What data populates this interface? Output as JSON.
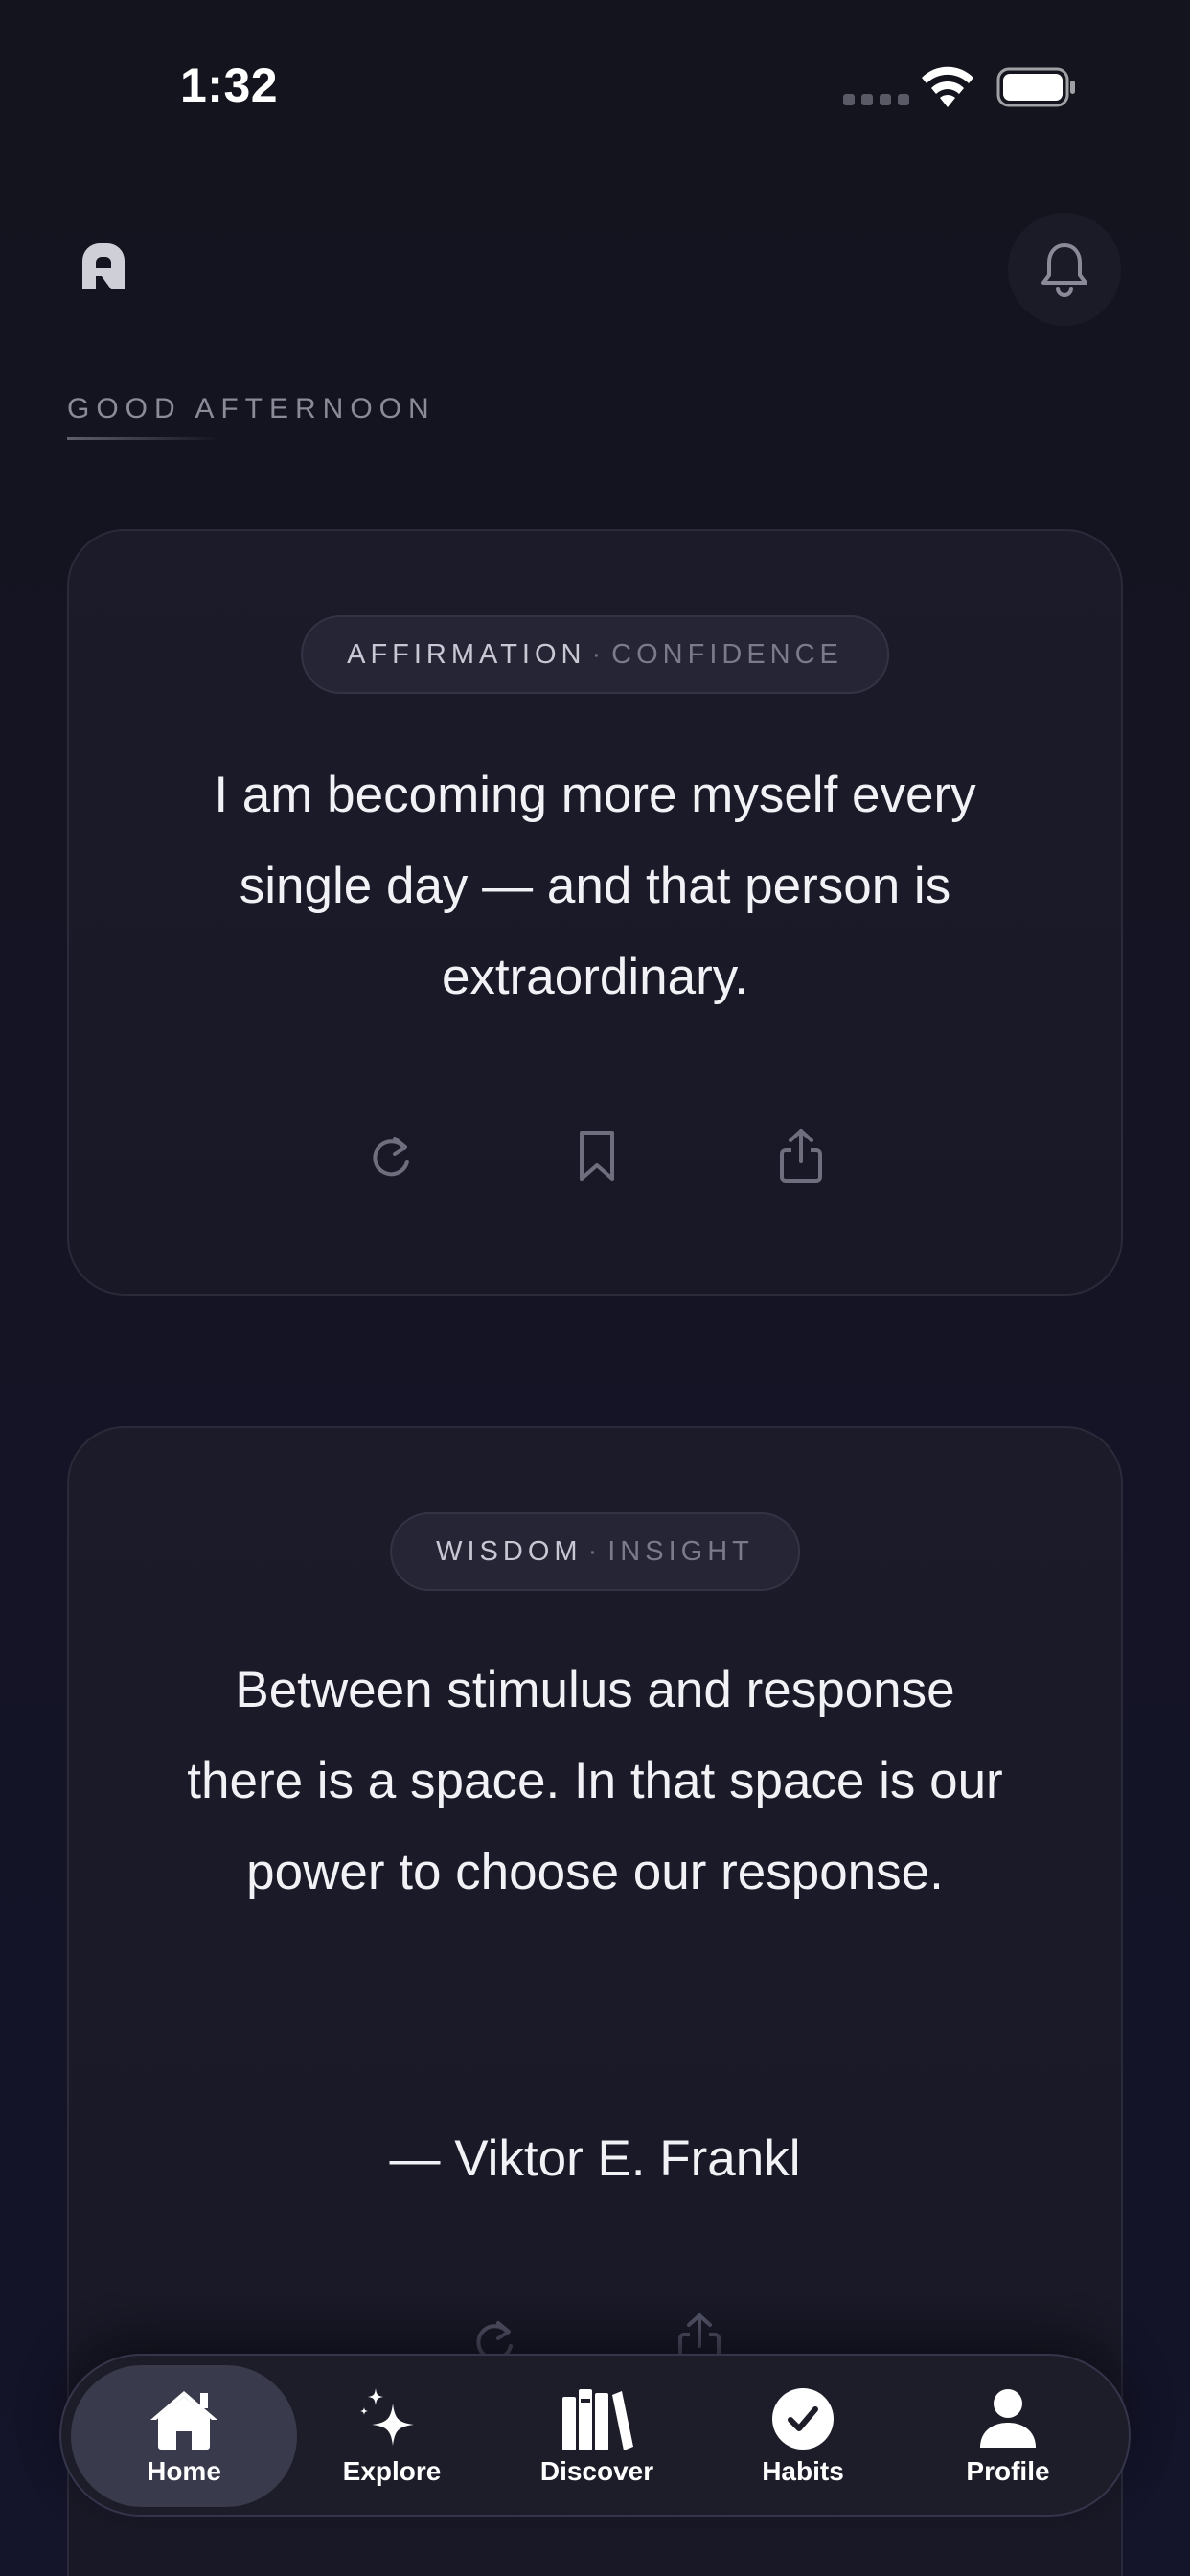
{
  "status_bar": {
    "time": "1:32"
  },
  "header": {
    "greeting": "GOOD AFTERNOON"
  },
  "cards": [
    {
      "category": "AFFIRMATION",
      "separator": "·",
      "subcategory": "CONFIDENCE",
      "quote": "I am becoming more myself every single day — and that person is extraordinary.",
      "actions": [
        "refresh-icon",
        "bookmark-icon",
        "share-icon"
      ]
    },
    {
      "category": "WISDOM",
      "separator": "·",
      "subcategory": "INSIGHT",
      "quote": "Between stimulus and response there is a space. In that space is our power to choose our response.",
      "author": "— Viktor E. Frankl",
      "actions": [
        "refresh-icon",
        "share-icon"
      ]
    }
  ],
  "tabbar": {
    "active": "Home",
    "items": [
      {
        "label": "Home",
        "icon": "home-icon"
      },
      {
        "label": "Explore",
        "icon": "sparkles-icon"
      },
      {
        "label": "Discover",
        "icon": "books-icon"
      },
      {
        "label": "Habits",
        "icon": "checkmark-circle-icon"
      },
      {
        "label": "Profile",
        "icon": "person-icon"
      }
    ]
  },
  "colors": {
    "background": "#14141e",
    "card": "#1b1b29",
    "pill": "#252535",
    "active_tab": "#3a3a4d"
  }
}
